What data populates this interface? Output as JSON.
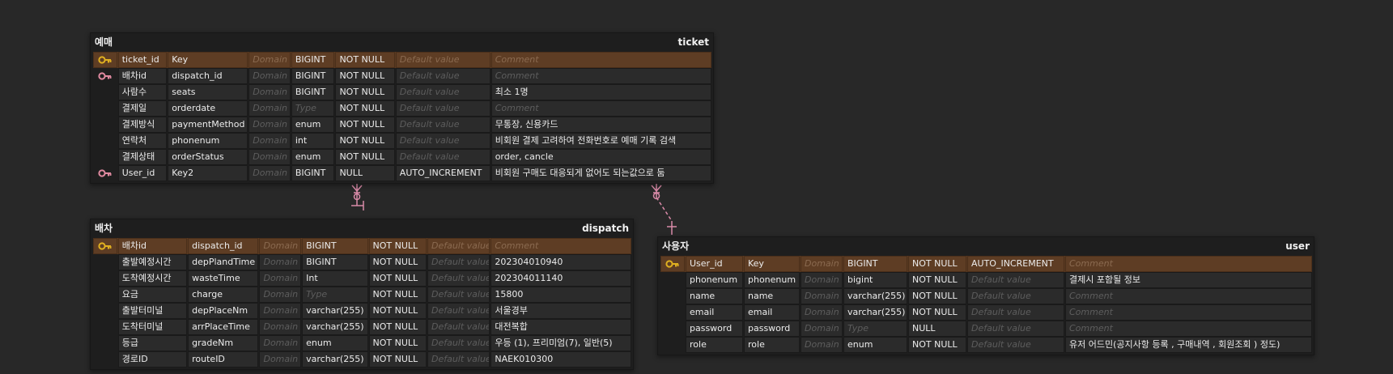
{
  "placeholders": {
    "domain": "Domain",
    "type": "Type",
    "default": "Default value",
    "comment": "Comment"
  },
  "colors": {
    "background": "#282828",
    "pk_row": "#5b3a21",
    "pk_key": "#e0b020",
    "fk_key": "#e08aa0",
    "relation": "#d98aa8"
  },
  "ticket": {
    "logical_name": "예매",
    "physical_name": "ticket",
    "columns": [
      {
        "key_icon": "primary-key-icon",
        "logical": "ticket_id",
        "physical": "Key",
        "domain": "Domain",
        "type": "BIGINT",
        "null": "NOT NULL",
        "default": "Default value",
        "comment": "Comment"
      },
      {
        "key_icon": "foreign-key-icon",
        "logical": "배차id",
        "physical": "dispatch_id",
        "domain": "Domain",
        "type": "BIGINT",
        "null": "NOT NULL",
        "default": "Default value",
        "comment": "Comment"
      },
      {
        "key_icon": "",
        "logical": "사람수",
        "physical": "seats",
        "domain": "Domain",
        "type": "BIGINT",
        "null": "NOT NULL",
        "default": "Default value",
        "comment": "최소 1명"
      },
      {
        "key_icon": "",
        "logical": "결제일",
        "physical": "orderdate",
        "domain": "Domain",
        "type": "Type",
        "null": "NOT NULL",
        "default": "Default value",
        "comment": "Comment"
      },
      {
        "key_icon": "",
        "logical": "결제방식",
        "physical": "paymentMethod",
        "domain": "Domain",
        "type": "enum",
        "null": "NOT NULL",
        "default": "Default value",
        "comment": "무통장, 신용카드"
      },
      {
        "key_icon": "",
        "logical": "연락처",
        "physical": "phonenum",
        "domain": "Domain",
        "type": "int",
        "null": "NOT NULL",
        "default": "Default value",
        "comment": "비회원 결제 고려하여 전화번호로 예매 기록 검색"
      },
      {
        "key_icon": "",
        "logical": "결제상태",
        "physical": "orderStatus",
        "domain": "Domain",
        "type": "enum",
        "null": "NOT NULL",
        "default": "Default value",
        "comment": "order, cancle"
      },
      {
        "key_icon": "foreign-key-icon",
        "logical": "User_id",
        "physical": "Key2",
        "domain": "Domain",
        "type": "BIGINT",
        "null": "NULL",
        "default": "AUTO_INCREMENT",
        "comment": "비회원 구매도 대응되게 없어도 되는값으로 둠"
      }
    ]
  },
  "dispatch": {
    "logical_name": "배차",
    "physical_name": "dispatch",
    "columns": [
      {
        "key_icon": "primary-key-icon",
        "logical": "배차id",
        "physical": "dispatch_id",
        "domain": "Domain",
        "type": "BIGINT",
        "null": "NOT NULL",
        "default": "Default value",
        "comment": "Comment"
      },
      {
        "key_icon": "",
        "logical": "출발예정시간",
        "physical": "depPlandTime",
        "domain": "Domain",
        "type": "BIGINT",
        "null": "NOT NULL",
        "default": "Default value",
        "comment": "202304010940"
      },
      {
        "key_icon": "",
        "logical": "도착예정시간",
        "physical": "wasteTime",
        "domain": "Domain",
        "type": "Int",
        "null": "NOT NULL",
        "default": "Default value",
        "comment": "202304011140"
      },
      {
        "key_icon": "",
        "logical": "요금",
        "physical": "charge",
        "domain": "Domain",
        "type": "Type",
        "null": "NOT NULL",
        "default": "Default value",
        "comment": "15800"
      },
      {
        "key_icon": "",
        "logical": "출발터미널",
        "physical": "depPlaceNm",
        "domain": "Domain",
        "type": "varchar(255)",
        "null": "NOT NULL",
        "default": "Default value",
        "comment": "서울경부"
      },
      {
        "key_icon": "",
        "logical": "도착터미널",
        "physical": "arrPlaceTime",
        "domain": "Domain",
        "type": "varchar(255)",
        "null": "NOT NULL",
        "default": "Default value",
        "comment": "대전복합"
      },
      {
        "key_icon": "",
        "logical": "등급",
        "physical": "gradeNm",
        "domain": "Domain",
        "type": "enum",
        "null": "NOT NULL",
        "default": "Default value",
        "comment": "우등 (1), 프리미엄(7), 일반(5)"
      },
      {
        "key_icon": "",
        "logical": "경로ID",
        "physical": "routeID",
        "domain": "Domain",
        "type": "varchar(255)",
        "null": "NOT NULL",
        "default": "Default value",
        "comment": "NAEK010300"
      }
    ]
  },
  "user": {
    "logical_name": "사용자",
    "physical_name": "user",
    "columns": [
      {
        "key_icon": "primary-key-icon",
        "logical": "User_id",
        "physical": "Key",
        "domain": "Domain",
        "type": "BIGINT",
        "null": "NOT NULL",
        "default": "AUTO_INCREMENT",
        "comment": "Comment"
      },
      {
        "key_icon": "",
        "logical": "phonenum",
        "physical": "phonenum",
        "domain": "Domain",
        "type": "bigint",
        "null": "NOT NULL",
        "default": "Default value",
        "comment": "결제시 포함될 정보"
      },
      {
        "key_icon": "",
        "logical": "name",
        "physical": "name",
        "domain": "Domain",
        "type": "varchar(255)",
        "null": "NOT NULL",
        "default": "Default value",
        "comment": "Comment"
      },
      {
        "key_icon": "",
        "logical": "email",
        "physical": "email",
        "domain": "Domain",
        "type": "varchar(255)",
        "null": "NOT NULL",
        "default": "Default value",
        "comment": "Comment"
      },
      {
        "key_icon": "",
        "logical": "password",
        "physical": "password",
        "domain": "Domain",
        "type": "Type",
        "null": "NULL",
        "default": "Default value",
        "comment": "Comment"
      },
      {
        "key_icon": "",
        "logical": "role",
        "physical": "role",
        "domain": "Domain",
        "type": "enum",
        "null": "NOT NULL",
        "default": "Default value",
        "comment": "유저 어드민(공지사항 등록 , 구매내역 , 회원조회 ) 정도)"
      }
    ]
  }
}
